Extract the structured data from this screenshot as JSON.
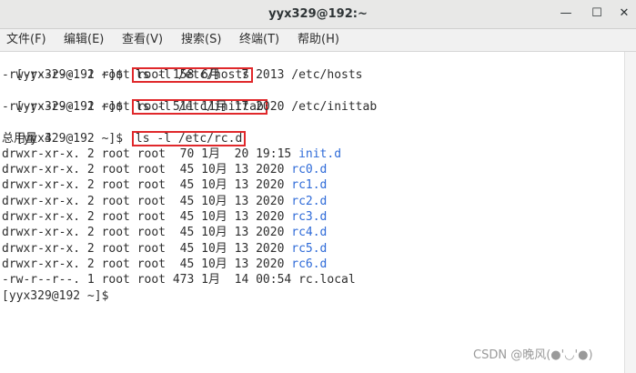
{
  "window": {
    "title": "yyx329@192:~",
    "minimize_glyph": "—",
    "maximize_glyph": "☐",
    "close_glyph": "✕"
  },
  "menu": {
    "file": "文件(F)",
    "edit": "编辑(E)",
    "view": "查看(V)",
    "search": "搜索(S)",
    "terminal": "终端(T)",
    "help": "帮助(H)"
  },
  "terminal": {
    "prompt": "[yyx329@192 ~]$ ",
    "cmd1": "ls -l /etc/hosts",
    "out1": "-rw-r--r--. 1 root root 158 6月   7 2013 /etc/hosts",
    "cmd2": "ls -l /etc/inittab",
    "out2": "-rw-r--r--. 1 root root 511 11月 17 2020 /etc/inittab",
    "cmd3": "ls -l /etc/rc.d",
    "total": "总用量 4",
    "rows": [
      {
        "meta": "drwxr-xr-x. 2 root root  70 1月  20 19:15 ",
        "name": "init.d",
        "blue": true
      },
      {
        "meta": "drwxr-xr-x. 2 root root  45 10月 13 2020 ",
        "name": "rc0.d",
        "blue": true
      },
      {
        "meta": "drwxr-xr-x. 2 root root  45 10月 13 2020 ",
        "name": "rc1.d",
        "blue": true
      },
      {
        "meta": "drwxr-xr-x. 2 root root  45 10月 13 2020 ",
        "name": "rc2.d",
        "blue": true
      },
      {
        "meta": "drwxr-xr-x. 2 root root  45 10月 13 2020 ",
        "name": "rc3.d",
        "blue": true
      },
      {
        "meta": "drwxr-xr-x. 2 root root  45 10月 13 2020 ",
        "name": "rc4.d",
        "blue": true
      },
      {
        "meta": "drwxr-xr-x. 2 root root  45 10月 13 2020 ",
        "name": "rc5.d",
        "blue": true
      },
      {
        "meta": "drwxr-xr-x. 2 root root  45 10月 13 2020 ",
        "name": "rc6.d",
        "blue": true
      },
      {
        "meta": "-rw-r--r--. 1 root root 473 1月  14 00:54 ",
        "name": "rc.local",
        "blue": false
      }
    ],
    "final_prompt": "[yyx329@192 ~]$"
  },
  "watermark": "CSDN @晚风(●'◡'●)",
  "colors": {
    "highlight_box": "#e0282b",
    "directory": "#2f6bd8"
  }
}
